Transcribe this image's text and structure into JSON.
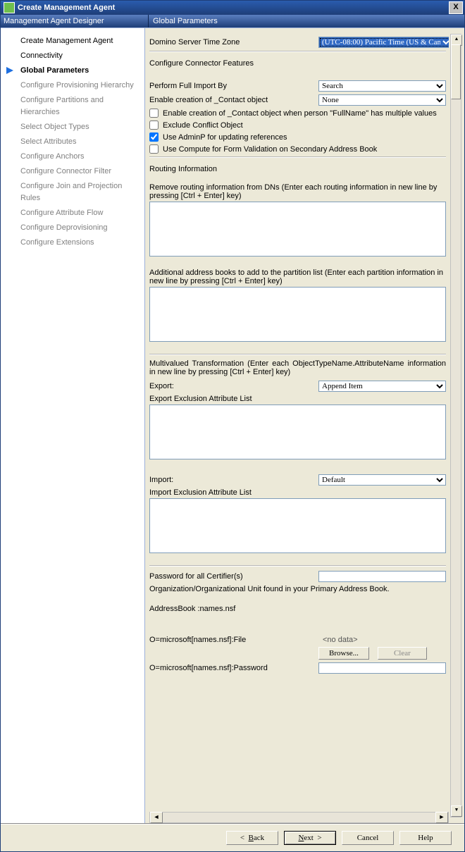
{
  "window": {
    "title": "Create Management Agent",
    "close": "X"
  },
  "header": {
    "left": "Management Agent Designer",
    "right": "Global Parameters"
  },
  "nav": [
    {
      "label": "Create Management Agent",
      "state": "black"
    },
    {
      "label": "Connectivity",
      "state": "black"
    },
    {
      "label": "Global Parameters",
      "state": "current"
    },
    {
      "label": "Configure Provisioning Hierarchy",
      "state": ""
    },
    {
      "label": "Configure Partitions and Hierarchies",
      "state": ""
    },
    {
      "label": "Select Object Types",
      "state": ""
    },
    {
      "label": "Select Attributes",
      "state": ""
    },
    {
      "label": "Configure Anchors",
      "state": ""
    },
    {
      "label": "Configure Connector Filter",
      "state": ""
    },
    {
      "label": "Configure Join and Projection Rules",
      "state": ""
    },
    {
      "label": "Configure Attribute Flow",
      "state": ""
    },
    {
      "label": "Configure Deprovisioning",
      "state": ""
    },
    {
      "label": "Configure Extensions",
      "state": ""
    }
  ],
  "tz": {
    "label": "Domino Server Time Zone",
    "value": "(UTC-08:00) Pacific Time (US & Can"
  },
  "features": {
    "title": "Configure Connector Features",
    "import_label": "Perform Full Import By",
    "import_value": "Search",
    "contact_label": "Enable creation of _Contact object",
    "contact_value": "None",
    "cb1": "Enable creation of _Contact object when person \"FullName\" has multiple values",
    "cb2": "Exclude Conflict Object",
    "cb3": "Use AdminP for updating references",
    "cb4": "Use Compute for Form Validation on Secondary Address Book"
  },
  "routing": {
    "title": "Routing Information",
    "remove_label": "Remove routing information from DNs (Enter each routing information in new line by pressing [Ctrl + Enter] key)",
    "add_label": "Additional address books to add to the partition list (Enter each partition information in new line by pressing [Ctrl + Enter] key)"
  },
  "multi": {
    "title": "Multivalued Transformation (Enter each ObjectTypeName.AttributeName information in new line by pressing [Ctrl + Enter] key)",
    "export_label": "Export:",
    "export_value": "Append Item",
    "export_list_label": "Export Exclusion Attribute List",
    "import_label": "Import:",
    "import_value": "Default",
    "import_list_label": "Import Exclusion Attribute List"
  },
  "cert": {
    "pw_label": "Password for all Certifier(s)",
    "org_label": "Organization/Organizational Unit found in your Primary Address Book.",
    "ab_label": "AddressBook :names.nsf",
    "file_label": "O=microsoft[names.nsf]:File",
    "nodata": "<no data>",
    "browse": "Browse...",
    "clear": "Clear",
    "pw2_label": "O=microsoft[names.nsf]:Password"
  },
  "footer": {
    "back": "Back",
    "next": "Next",
    "cancel": "Cancel",
    "help": "Help"
  }
}
